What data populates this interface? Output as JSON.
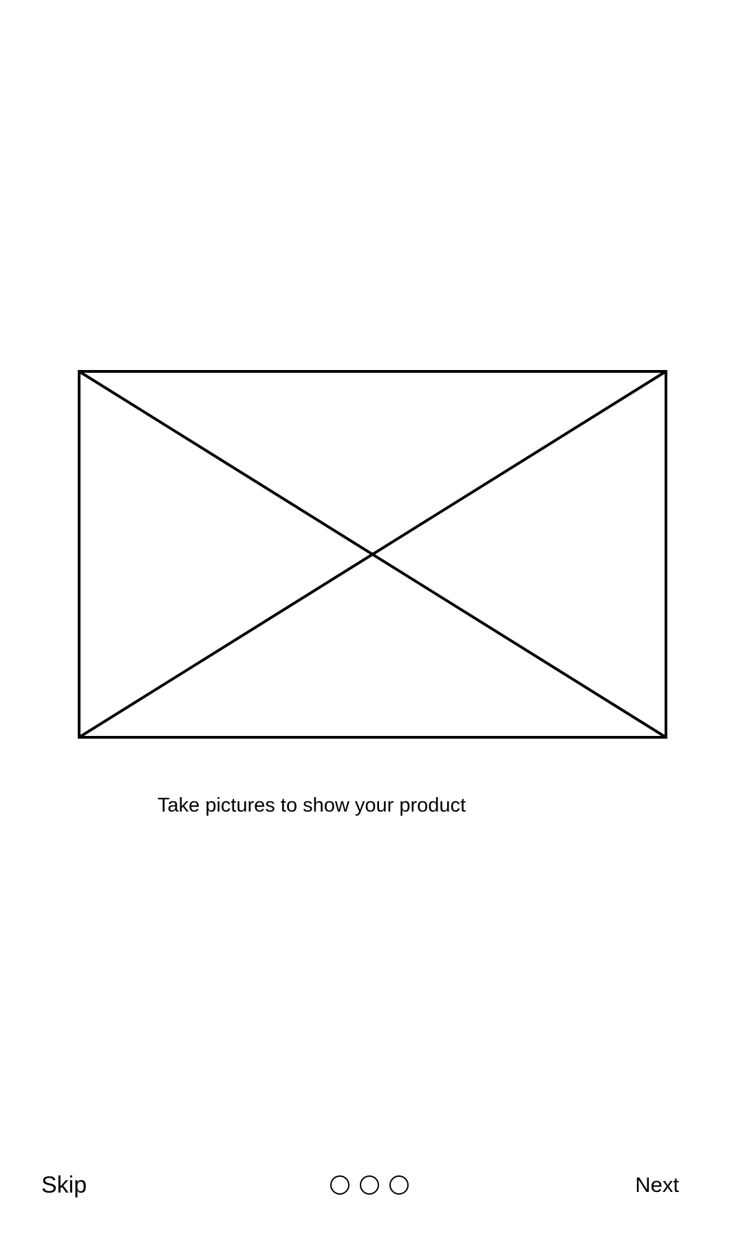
{
  "onboarding": {
    "caption": "Take pictures to show your product",
    "image_icon": "image-placeholder-icon"
  },
  "footer": {
    "skip_label": "Skip",
    "next_label": "Next",
    "page_count": 3,
    "active_page": null
  },
  "colors": {
    "background": "#ffffff",
    "foreground": "#000000"
  }
}
